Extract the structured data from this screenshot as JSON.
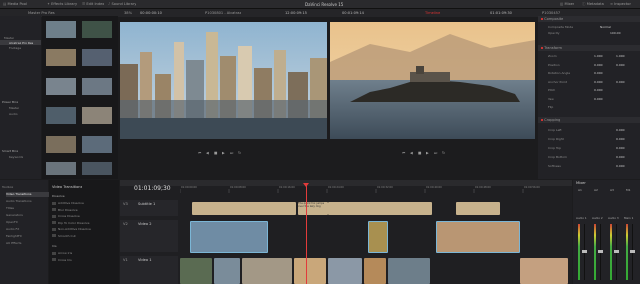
{
  "app": {
    "title": "DaVinci Resolve 15"
  },
  "topbar": {
    "left": [
      {
        "name": "media-pool",
        "label": "Media Pool"
      },
      {
        "name": "effects-library",
        "label": "Effects Library"
      },
      {
        "name": "edit-index",
        "label": "Edit Index"
      },
      {
        "name": "sound-library",
        "label": "Sound Library"
      }
    ],
    "right": [
      {
        "name": "mixer",
        "label": "Mixer"
      },
      {
        "name": "metadata",
        "label": "Metadata"
      },
      {
        "name": "inspector",
        "label": "Inspector"
      }
    ]
  },
  "viewer_bar": {
    "bin": "Master Pro Res",
    "zoom": "38%",
    "src_tc": "00:00:00:10",
    "src_clip": "P1030801 - Alcatraz",
    "src_dur": "12:00:09:15",
    "tl_dur": "00:01:09:14",
    "timeline_name": "Timeline",
    "rec_tc": "01:01:09:30",
    "rec_clip": "P1030457"
  },
  "bins": {
    "top": [
      "Master",
      "Alcatraz Pro Res",
      "Footage"
    ],
    "power_label": "Power Bins",
    "power_items": [
      "Master",
      "Audio"
    ],
    "smart_label": "Smart Bins",
    "smart_items": [
      "Keywords"
    ]
  },
  "inspector": {
    "composite": "Composite",
    "composite_mode_label": "Composite Mode",
    "composite_mode": "Normal",
    "opacity_label": "Opacity",
    "opacity": "100.00",
    "transform": "Transform",
    "transform_rows": [
      {
        "label": "Zoom",
        "a": "1.000",
        "b": "1.000"
      },
      {
        "label": "Position",
        "a": "0.000",
        "b": "0.000"
      },
      {
        "label": "Rotation Angle",
        "a": "0.000",
        "b": ""
      },
      {
        "label": "Anchor Point",
        "a": "0.000",
        "b": "0.000"
      },
      {
        "label": "Pitch",
        "a": "0.000",
        "b": ""
      },
      {
        "label": "Yaw",
        "a": "0.000",
        "b": ""
      },
      {
        "label": "Flip",
        "a": "",
        "b": ""
      }
    ],
    "cropping": "Cropping",
    "crop_rows": [
      {
        "label": "Crop Left",
        "v": "0.000"
      },
      {
        "label": "Crop Right",
        "v": "0.000"
      },
      {
        "label": "Crop Top",
        "v": "0.000"
      },
      {
        "label": "Crop Bottom",
        "v": "0.000"
      },
      {
        "label": "Softness",
        "v": "0.000"
      }
    ]
  },
  "effects": {
    "tree": [
      "Toolbox",
      "Video Transitions",
      "Audio Transitions",
      "Titles",
      "Generators",
      "OpenFX",
      "Audio FX",
      "FairlightFX",
      "AU Effects"
    ],
    "header": "Video Transitions",
    "groups": [
      {
        "label": "Dissolve",
        "items": [
          "Additive Dissolve",
          "Blur Dissolve",
          "Cross Dissolve",
          "Dip To Color Dissolve",
          "Non-Additive Dissolve",
          "Smooth Cut"
        ]
      },
      {
        "label": "Iris",
        "items": [
          "Arrow Iris",
          "Cross Iris"
        ]
      }
    ]
  },
  "timeline": {
    "timecode": "01:01:09;30",
    "ruler": [
      "01:00:00:00",
      "01:00:08:00",
      "01:00:16:00",
      "01:00:24:00",
      "01:00:32:00",
      "01:00:40:00",
      "01:00:48:00",
      "01:00:56:00"
    ],
    "tracks": [
      {
        "id": "V3",
        "name": "Subtitle 1"
      },
      {
        "id": "V2",
        "name": "Video 2"
      },
      {
        "id": "V1",
        "name": "Video 1"
      }
    ],
    "subtitle_text": "The quick fox jumps over the lazy dog"
  },
  "mixer": {
    "title": "Mixer",
    "channels": [
      "A1",
      "A2",
      "A3",
      "M1"
    ],
    "strips": [
      "Audio 1",
      "Audio 2",
      "Audio 3",
      "Main 1"
    ]
  }
}
